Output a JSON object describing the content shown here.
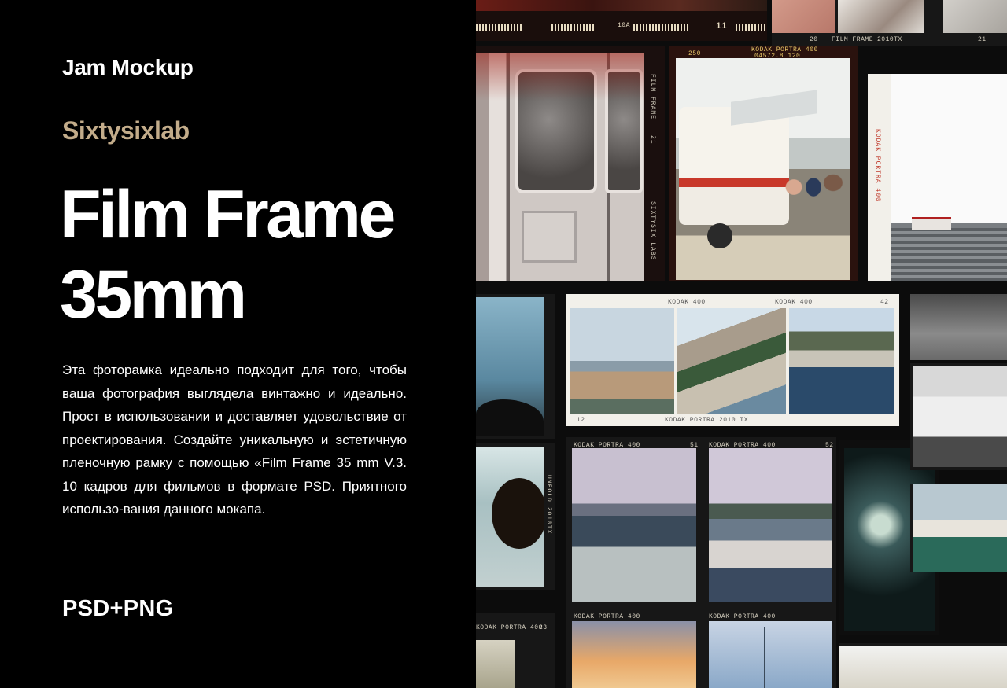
{
  "brand": "Jam Mockup",
  "author": "Sixtysixlab",
  "title_line1": "Film Frame",
  "title_line2": "35mm",
  "description": "Эта фоторамка идеально подходит для того, чтобы ваша фотография выглядела винтажно и идеально. Прост в использовании и доставляет удовольствие от проектирования. Создайте уникальную и эстетичную пленочную рамку с помощью «Film Frame 35 mm V.3. 10 кадров для фильмов в формате PSD. Приятного использо-вания данного мокапа.",
  "formats": "PSD+PNG",
  "film_labels": {
    "film_frame_top": "FILM FRAME",
    "film_frame_code": "2010TX",
    "num_20": "20",
    "num_21": "21",
    "num_11": "11",
    "num_10a": "10A",
    "kodak_top": "KODAK PORTRA 400",
    "kodak_top_code": "04572.8  120",
    "frame_250": "250",
    "film_frame_side": "FILM FRAME",
    "sixtysix_side": "SIXTYSIX LABS",
    "side_num": "21",
    "kodak_400": "KODAK 400",
    "num_42": "42",
    "num_12": "12",
    "kodak_bottom": "KODAK PORTRA 2010 TX",
    "kodak_portra_400": "KODAK PORTRA 400",
    "num_51": "51",
    "num_52": "52",
    "num_23": "23",
    "kodak_red_side": "KODAK PORTRA 400",
    "unfold_side": "UNFOLD 2010TX"
  }
}
